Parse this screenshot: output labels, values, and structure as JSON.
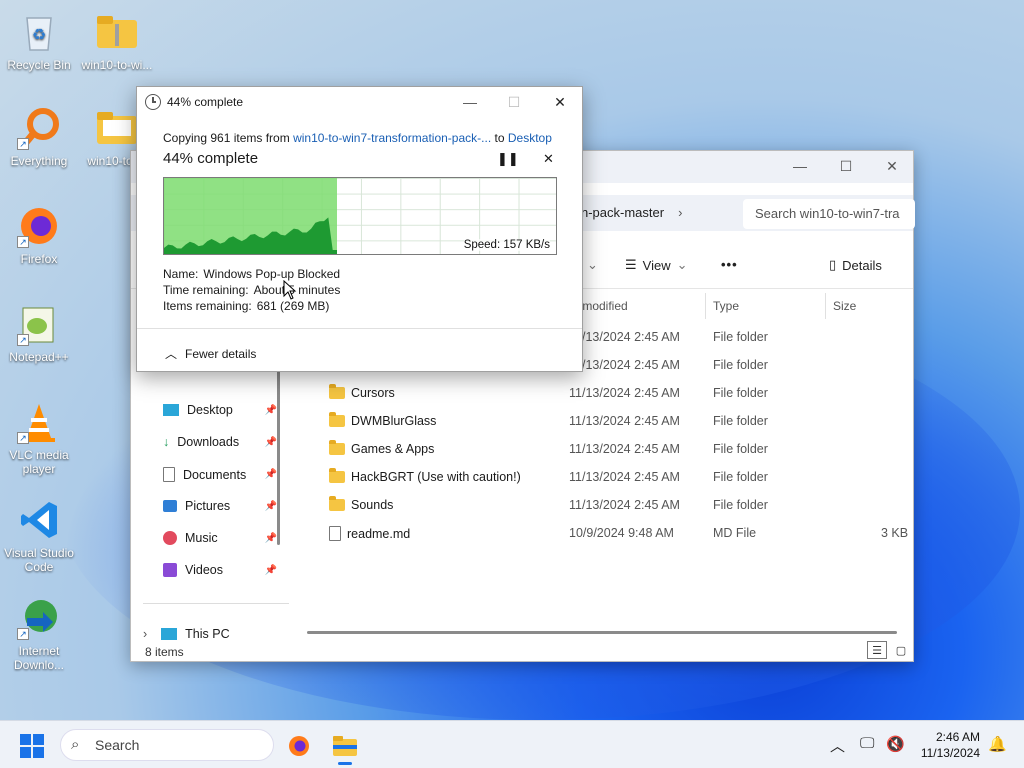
{
  "desktop": {
    "icons": [
      {
        "label": "Recycle Bin"
      },
      {
        "label": "win10-to-wi..."
      },
      {
        "label": "Everything"
      },
      {
        "label": "win10-to-..."
      },
      {
        "label": "Firefox"
      },
      {
        "label": "Notepad++"
      },
      {
        "label": "VLC media player"
      },
      {
        "label": "Visual Studio Code"
      },
      {
        "label": "Internet Downlo..."
      }
    ]
  },
  "copy_dialog": {
    "title": "44% complete",
    "copying_prefix": "Copying 961 items from",
    "source": "win10-to-win7-transformation-pack-...",
    "to_word": "to",
    "destination": "Desktop",
    "percent_text": "44% complete",
    "progress": 0.44,
    "speed": "Speed: 157 KB/s",
    "name_label": "Name:",
    "name_value": "Windows Pop-up Blocked",
    "time_label": "Time remaining:",
    "time_value": "About 5 minutes",
    "items_label": "Items remaining:",
    "items_value": "681 (269 MB)",
    "fewer_details": "Fewer details"
  },
  "explorer": {
    "path_tail": "n-pack-master",
    "search_placeholder": "Search win10-to-win7-tra",
    "view_label": "View",
    "details_label": "Details",
    "columns": {
      "date": "te modified",
      "type": "Type",
      "size": "Size"
    },
    "nav": [
      {
        "label": "Desktop"
      },
      {
        "label": "Downloads"
      },
      {
        "label": "Documents"
      },
      {
        "label": "Pictures"
      },
      {
        "label": "Music"
      },
      {
        "label": "Videos"
      }
    ],
    "this_pc": "This PC",
    "files": [
      {
        "name": "",
        "date": "11/13/2024 2:45 AM",
        "type": "File folder",
        "size": ""
      },
      {
        "name": "",
        "date": "11/13/2024 2:45 AM",
        "type": "File folder",
        "size": ""
      },
      {
        "name": "Cursors",
        "date": "11/13/2024 2:45 AM",
        "type": "File folder",
        "size": ""
      },
      {
        "name": "DWMBlurGlass",
        "date": "11/13/2024 2:45 AM",
        "type": "File folder",
        "size": ""
      },
      {
        "name": "Games & Apps",
        "date": "11/13/2024 2:45 AM",
        "type": "File folder",
        "size": ""
      },
      {
        "name": "HackBGRT (Use with caution!)",
        "date": "11/13/2024 2:45 AM",
        "type": "File folder",
        "size": ""
      },
      {
        "name": "Sounds",
        "date": "11/13/2024 2:45 AM",
        "type": "File folder",
        "size": ""
      },
      {
        "name": "readme.md",
        "date": "10/9/2024 9:48 AM",
        "type": "MD File",
        "size": "3 KB"
      }
    ],
    "status": "8 items"
  },
  "taskbar": {
    "search_placeholder": "Search",
    "time": "2:46 AM",
    "date": "11/13/2024"
  },
  "colors": {
    "accent": "#1a73e8",
    "link": "#1a5fb4",
    "progress_fill": "#7cdc6e"
  }
}
